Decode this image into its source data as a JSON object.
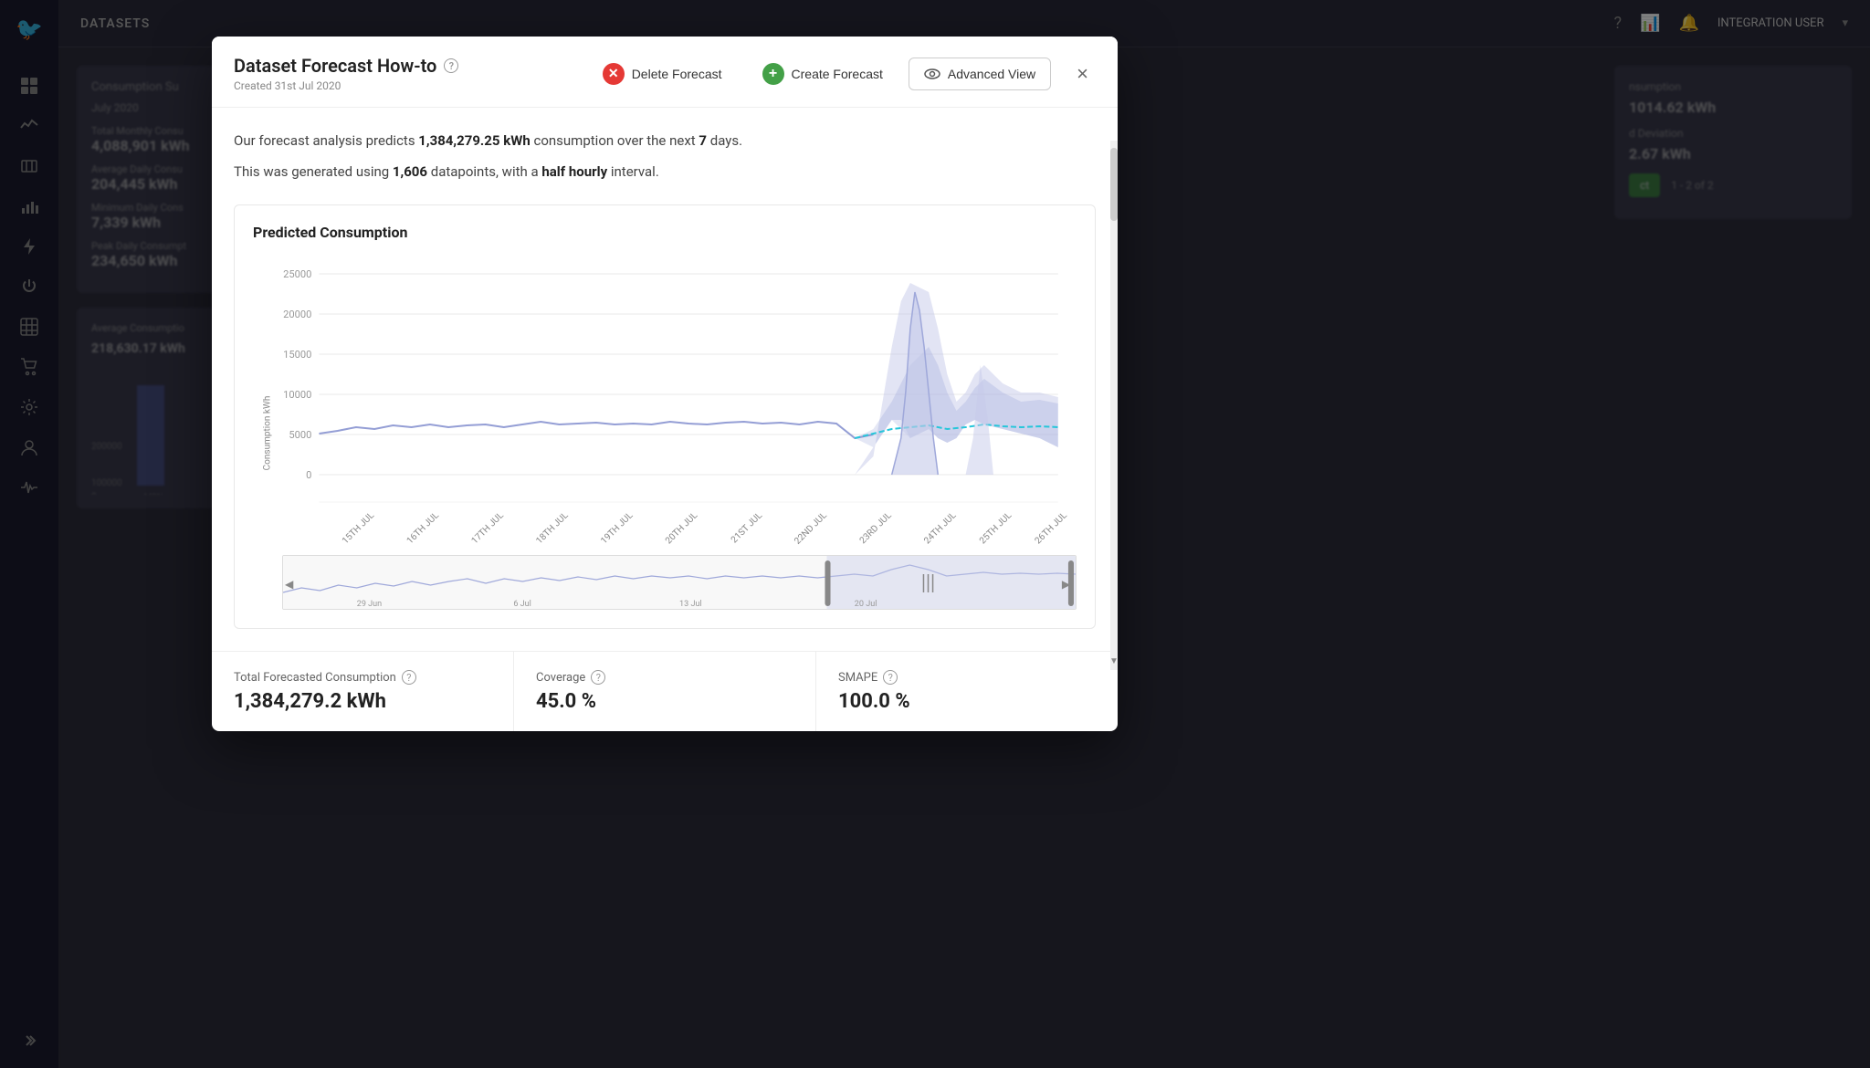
{
  "topbar": {
    "title": "DATASETS",
    "user": "INTEGRATION USER",
    "icons": [
      "help",
      "chart",
      "bell"
    ]
  },
  "sidebar": {
    "items": [
      {
        "name": "logo",
        "icon": "🐦",
        "active": true
      },
      {
        "name": "dashboard",
        "icon": "⊞"
      },
      {
        "name": "activity",
        "icon": "📈"
      },
      {
        "name": "map",
        "icon": "🗺"
      },
      {
        "name": "chart-bar",
        "icon": "📊"
      },
      {
        "name": "lightning",
        "icon": "⚡"
      },
      {
        "name": "power",
        "icon": "⚡"
      },
      {
        "name": "bar-chart",
        "icon": "▦"
      },
      {
        "name": "shop",
        "icon": "🛒"
      },
      {
        "name": "settings",
        "icon": "⚙"
      },
      {
        "name": "user",
        "icon": "👤"
      },
      {
        "name": "pulse",
        "icon": "〜"
      },
      {
        "name": "expand",
        "icon": "»"
      }
    ]
  },
  "modal": {
    "title": "Dataset Forecast How-to",
    "help_icon": "?",
    "subtitle": "Created 31st Jul 2020",
    "delete_label": "Delete Forecast",
    "create_label": "Create Forecast",
    "advanced_label": "Advanced View",
    "close_label": "×",
    "description_line1_prefix": "Our forecast analysis predicts ",
    "description_line1_value": "1,384,279.25 kWh",
    "description_line1_suffix": " consumption over the next ",
    "description_line1_days": "7",
    "description_line1_end": " days.",
    "description_line2_prefix": "This was generated using ",
    "description_line2_points": "1,606",
    "description_line2_mid": " datapoints, with a ",
    "description_line2_interval": "half hourly",
    "description_line2_end": " interval.",
    "chart": {
      "title": "Predicted Consumption",
      "y_axis_label": "Consumption kWh",
      "y_ticks": [
        "25000",
        "20000",
        "15000",
        "10000",
        "5000",
        "0"
      ],
      "x_labels": [
        "15TH JUL",
        "16TH JUL",
        "17TH JUL",
        "18TH JUL",
        "19TH JUL",
        "20TH JUL",
        "21ST JUL",
        "22ND JUL",
        "23RD JUL",
        "24TH JUL",
        "25TH JUL",
        "26TH JUL"
      ],
      "minimap_labels": [
        "29 Jun",
        "6 Jul",
        "13 Jul",
        "20 Jul"
      ]
    },
    "stats": [
      {
        "label": "Total Forecasted Consumption",
        "value": "1,384,279.2 kWh",
        "has_help": true
      },
      {
        "label": "Coverage",
        "value": "45.0 %",
        "has_help": true
      },
      {
        "label": "SMAPE",
        "value": "100.0 %",
        "has_help": true
      }
    ]
  },
  "background": {
    "monthly_consumption_label": "Total Monthly Consu",
    "monthly_consumption_value": "4,088,901 kWh",
    "avg_daily_label": "Average Daily Consu",
    "avg_daily_value": "204,445 kWh",
    "min_daily_label": "Minimum Daily Cons",
    "min_daily_value": "7,339 kWh",
    "peak_daily_label": "Peak Daily Consumpt",
    "peak_daily_value": "234,650 kWh",
    "avg_consumption_label": "Average Consumptio",
    "avg_consumption_value": "218,630.17 kWh",
    "consumption_summary": "Consumption Su",
    "month_label": "July 2020",
    "consumption_right": "1014.62 kWh",
    "deviation_right": "2.67 kWh",
    "pagination": "1 - 2 of 2"
  }
}
